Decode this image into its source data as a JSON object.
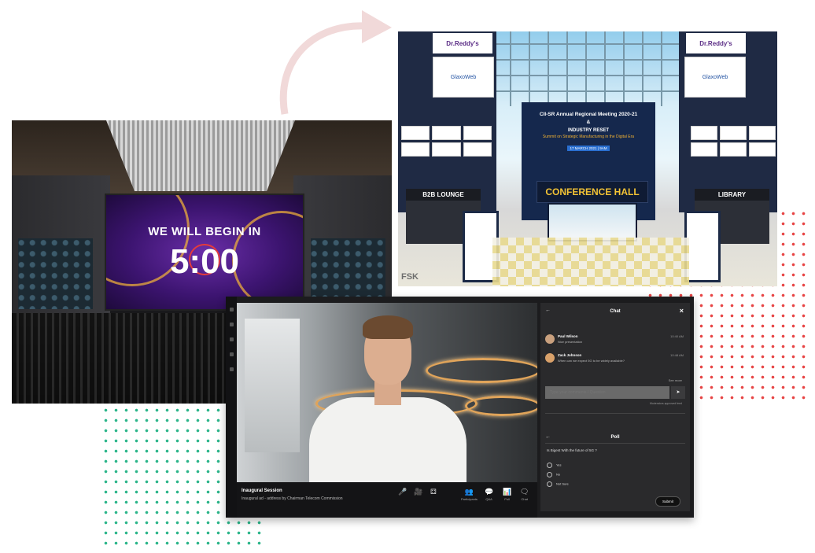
{
  "colors": {
    "dots_green": "#2bb58a",
    "dots_red": "#e84545",
    "arrow": "#f1d9d9",
    "accent_gold": "#f3c335",
    "ring": "#f6b637"
  },
  "auditorium": {
    "heading": "WE WILL BEGIN IN",
    "timer": "5:00"
  },
  "lobby": {
    "brand_left": "Dr.Reddy's",
    "brand_right": "Dr.Reddy's",
    "logo_left": "GlaxoWeb",
    "logo_right": "GlaxoWeb",
    "title": "CII-SR Annual Regional Meeting 2020-21",
    "amp": "&",
    "reset": "INDUSTRY RESET",
    "summit": "Summit on Strategic Manufacturing in the Digital Era",
    "date": "17 MARCH 2021 | 9AM",
    "hall": "CONFERENCE HALL",
    "left_booth": "B2B LOUNGE",
    "right_booth": "LIBRARY",
    "watermark": "FSK"
  },
  "call": {
    "session_name": "Inaugural Session",
    "session_desc": "Inaugural ad - address by Chairman Telecom Commission",
    "tools": [
      {
        "icon": "🎤",
        "label": ""
      },
      {
        "icon": "🎥",
        "label": ""
      },
      {
        "icon": "⚃",
        "label": ""
      },
      {
        "icon": "👥",
        "label": "Participants"
      },
      {
        "icon": "💬",
        "label": "Q&A"
      },
      {
        "icon": "📊",
        "label": "Poll"
      },
      {
        "icon": "🗨",
        "label": "Chat"
      }
    ],
    "chat": {
      "title": "Chat",
      "messages": [
        {
          "name": "Paul Wilson",
          "text": "Nice presentation",
          "time": "10:40 AM"
        },
        {
          "name": "Zack Johnson",
          "text": "When can we expect 5G to be widely available?",
          "time": "10:48 AM"
        }
      ],
      "see_more": "See more",
      "input_placeholder": "Type your comments / Question",
      "send": "➤",
      "note": "Moderators approved feed"
    },
    "poll": {
      "title": "Poll",
      "question": "Is Bigest With the future of 5G ?",
      "options": [
        "Yes",
        "No",
        "Not Sure"
      ],
      "submit": "Submit"
    }
  }
}
